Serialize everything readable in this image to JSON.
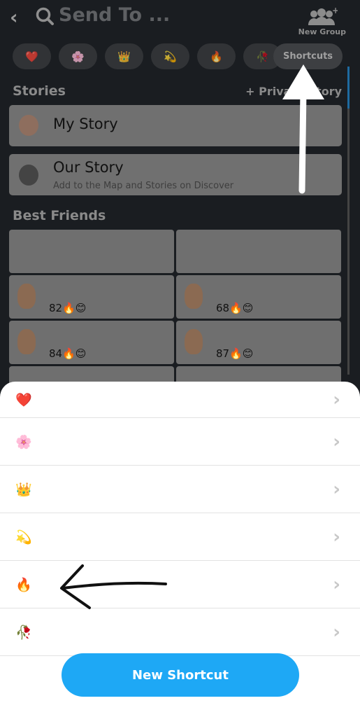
{
  "header": {
    "title": "Send To ...",
    "new_group_label": "New Group"
  },
  "chips": [
    {
      "emoji": "❤️"
    },
    {
      "emoji": "🌸"
    },
    {
      "emoji": "👑"
    },
    {
      "emoji": "💫"
    },
    {
      "emoji": "🔥"
    },
    {
      "emoji": "🥀"
    }
  ],
  "shortcuts_label": "Shortcuts",
  "stories": {
    "heading": "Stories",
    "private_story": "+ Private Story",
    "my_story": "My Story",
    "our_story": "Our Story",
    "our_story_sub": "Add to the Map and Stories on Discover"
  },
  "best_friends": {
    "heading": "Best Friends",
    "streaks": [
      "82🔥😊",
      "68🔥😊",
      "84🔥😊",
      "87🔥😊"
    ]
  },
  "sheet": {
    "rows": [
      {
        "emoji": "❤️"
      },
      {
        "emoji": "🌸"
      },
      {
        "emoji": "👑"
      },
      {
        "emoji": "💫"
      },
      {
        "emoji": "🔥"
      },
      {
        "emoji": "🥀"
      }
    ],
    "chevron": "›",
    "new_shortcut": "New Shortcut"
  },
  "colors": {
    "accent": "#1ea8f5",
    "background": "#1a1d21"
  }
}
